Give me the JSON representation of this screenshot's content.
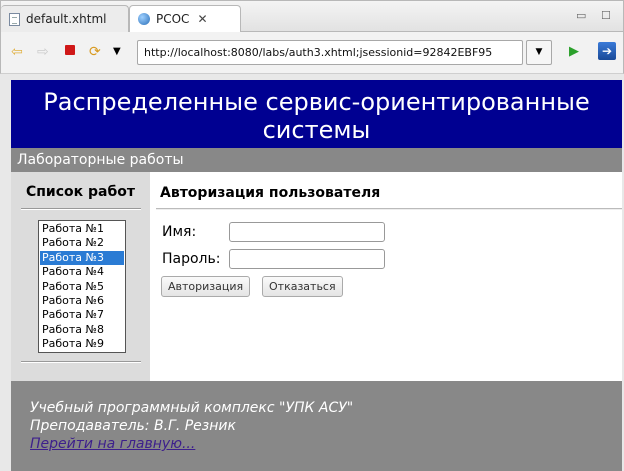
{
  "tabs": [
    {
      "label": "default.xhtml",
      "active": false
    },
    {
      "label": "РСОС",
      "active": true
    }
  ],
  "toolbar": {
    "url": "http://localhost:8080/labs/auth3.xhtml;jsessionid=92842EBF95"
  },
  "page": {
    "header_title": "Распределенные сервис-ориентированные системы",
    "subheader": "Лабораторные работы",
    "sidebar": {
      "title": "Список работ",
      "items": [
        "Работа №1",
        "Работа №2",
        "Работа №3",
        "Работа №4",
        "Работа №5",
        "Работа №6",
        "Работа №7",
        "Работа №8",
        "Работа №9"
      ],
      "selected_index": 2
    },
    "form": {
      "title": "Авторизация пользователя",
      "name_label": "Имя:",
      "name_value": "",
      "password_label": "Пароль:",
      "password_value": "",
      "login_button": "Авторизация",
      "cancel_button": "Отказаться"
    },
    "footer": {
      "line1": "Учебный программный комплекс \"УПК АСУ\"",
      "line2": "Преподаватель: В.Г. Резник",
      "link": "Перейти на главную..."
    }
  },
  "icons": {
    "back": "back-arrow-icon",
    "forward": "forward-arrow-icon",
    "stop": "stop-icon",
    "refresh": "refresh-icon",
    "go": "go-play-icon",
    "external": "open-external-browser-icon"
  },
  "colors": {
    "header_bg": "#000091",
    "band_bg": "#888888",
    "sidebar_bg": "#dcdcdc",
    "selection": "#2a7bd4",
    "link": "#3d1f8c"
  }
}
